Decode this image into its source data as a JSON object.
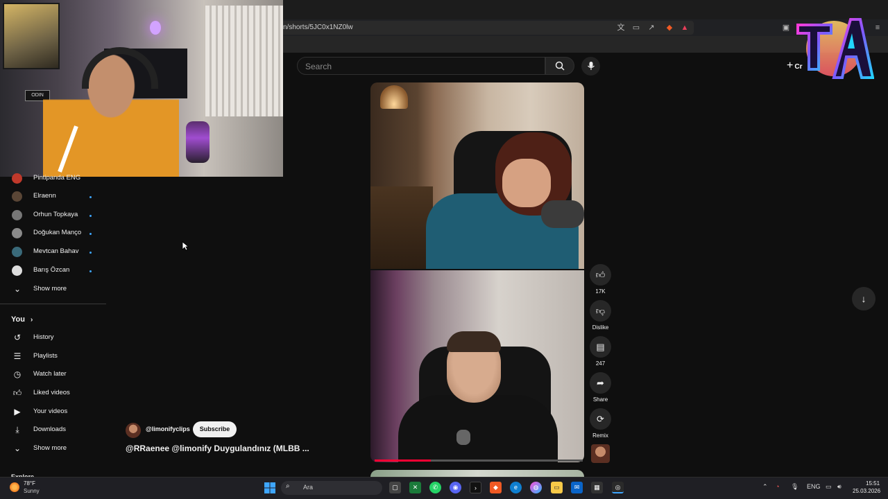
{
  "browser": {
    "url": "n/shorts/5JC0x1NZ0lw",
    "url_icons": [
      "translate-icon",
      "cast-icon",
      "share-icon",
      "brave-shield-icon",
      "brave-rewards-icon"
    ]
  },
  "header": {
    "search_placeholder": "Search",
    "create_partial": "Cr"
  },
  "webcam": {
    "sign_text": "ODIN"
  },
  "sidebar": {
    "subscriptions": [
      {
        "name": "Pintipanda ENG",
        "color": "#c0392b"
      },
      {
        "name": "Elraenn",
        "color": "#5a4636"
      },
      {
        "name": "Orhun Topkaya",
        "color": "#777777"
      },
      {
        "name": "Doğukan Manço",
        "color": "#8a8a8a"
      },
      {
        "name": "Mevtcan Bahav",
        "color": "#3a6a7a"
      },
      {
        "name": "Barış Özcan",
        "color": "#dddddd"
      }
    ],
    "show_more": "Show more",
    "you": {
      "heading": "You",
      "items": [
        {
          "label": "History",
          "icon": "history-icon"
        },
        {
          "label": "Playlists",
          "icon": "playlists-icon"
        },
        {
          "label": "Watch later",
          "icon": "watch-later-icon"
        },
        {
          "label": "Liked videos",
          "icon": "liked-videos-icon"
        },
        {
          "label": "Your videos",
          "icon": "your-videos-icon"
        },
        {
          "label": "Downloads",
          "icon": "downloads-icon"
        }
      ],
      "show_more": "Show more"
    },
    "explore_heading": "Explore"
  },
  "short": {
    "channel": "@limonifyclips",
    "subscribe": "Subscribe",
    "title": "@RRaenee @limonify Duygulandınız (MLBB ...",
    "progress": 0.27
  },
  "actions": {
    "likes": "17K",
    "dislike": "Dislike",
    "comments": "247",
    "share": "Share",
    "remix": "Remix"
  },
  "taskbar": {
    "weather_temp": "78°F",
    "weather_desc": "Sunny",
    "search": "Ara",
    "language": "ENG",
    "time": "15:51",
    "date": "25.03.2026"
  }
}
